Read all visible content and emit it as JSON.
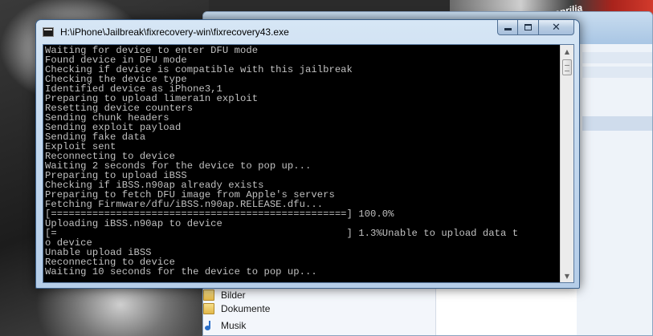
{
  "window": {
    "title": "H:\\iPhone\\Jailbreak\\fixrecovery-win\\fixrecovery43.exe",
    "icon": "console-app-icon"
  },
  "console": {
    "lines": [
      "Waiting for device to enter DFU mode",
      "Found device in DFU mode",
      "Checking if device is compatible with this jailbreak",
      "Checking the device type",
      "Identified device as iPhone3,1",
      "Preparing to upload limera1n exploit",
      "Resetting device counters",
      "Sending chunk headers",
      "Sending exploit payload",
      "Sending fake data",
      "Exploit sent",
      "Reconnecting to device",
      "Waiting 2 seconds for the device to pop up...",
      "Preparing to upload iBSS",
      "Checking if iBSS.n90ap already exists",
      "Preparing to fetch DFU image from Apple's servers",
      "Fetching Firmware/dfu/iBSS.n90ap.RELEASE.dfu...",
      "[==================================================] 100.0%",
      "Uploading iBSS.n90ap to device",
      "[=                                                 ] 1.3%Unable to upload data t",
      "o device",
      "Unable upload iBSS",
      "Reconnecting to device",
      "Waiting 10 seconds for the device to pop up..."
    ]
  },
  "explorer": {
    "nav_items": [
      {
        "label": "Bilder",
        "icon": "folder-icon"
      },
      {
        "label": "Dokumente",
        "icon": "folder-icon"
      },
      {
        "label": "Musik",
        "icon": "music-icon"
      }
    ]
  },
  "background": {
    "brand_text": "aprilia"
  }
}
